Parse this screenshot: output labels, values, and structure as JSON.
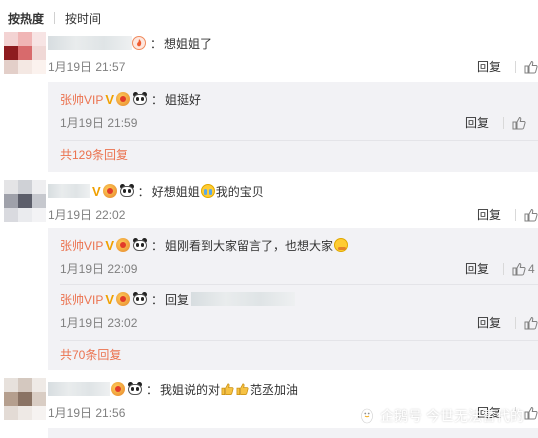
{
  "sort": {
    "hot": "按热度",
    "time": "按时间"
  },
  "labels": {
    "reply": "回复",
    "colon": "："
  },
  "c1": {
    "text": "想姐姐了",
    "time": "1月19日 21:57",
    "subs": [
      {
        "name": "张帅VIP",
        "text": "姐挺好",
        "time": "1月19日 21:59",
        "likes": ""
      }
    ],
    "total": "共129条回复"
  },
  "c2": {
    "text_a": "好想姐姐",
    "text_b": "我的宝贝",
    "time": "1月19日 22:02",
    "subs": [
      {
        "name": "张帅VIP",
        "text": "姐刚看到大家留言了，也想大家",
        "time": "1月19日 22:09",
        "likes": "4"
      },
      {
        "name": "张帅VIP",
        "text": "回复",
        "time": "1月19日 23:02",
        "likes": ""
      }
    ],
    "total": "共70条回复"
  },
  "c3": {
    "text_a": "我姐说的对",
    "text_b": "范丞加油",
    "time": "1月19日 21:56"
  },
  "watermark": "企鹅号 今世无法替代的",
  "icons": [
    "fire-icon",
    "vip-v-icon",
    "medal-icon",
    "panda-icon",
    "cry-emoji-icon",
    "hug-emoji-icon",
    "thumbs-up-icon",
    "like-icon",
    "penguin-logo-icon"
  ],
  "colors": {
    "accent": "#eb7350",
    "time": "#808080",
    "subBg": "#f2f2f5"
  }
}
